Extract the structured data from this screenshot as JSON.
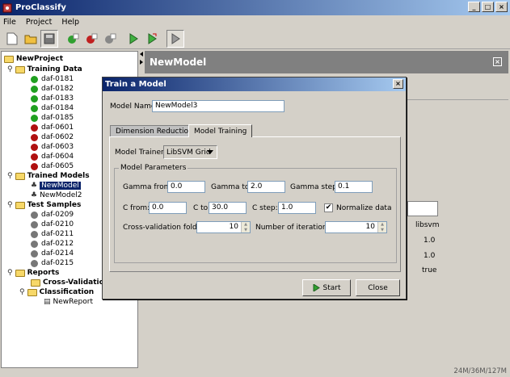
{
  "window": {
    "title": "ProClassify",
    "min": "_",
    "max": "□",
    "close": "×"
  },
  "menu": [
    "File",
    "Project",
    "Help"
  ],
  "tree": {
    "root": "NewProject",
    "training_data": {
      "label": "Training Data",
      "items": [
        {
          "label": "daf-0181",
          "color": "#20a020"
        },
        {
          "label": "daf-0182",
          "color": "#20a020"
        },
        {
          "label": "daf-0183",
          "color": "#20a020"
        },
        {
          "label": "daf-0184",
          "color": "#20a020"
        },
        {
          "label": "daf-0185",
          "color": "#20a020"
        },
        {
          "label": "daf-0601",
          "color": "#b01010"
        },
        {
          "label": "daf-0602",
          "color": "#b01010"
        },
        {
          "label": "daf-0603",
          "color": "#b01010"
        },
        {
          "label": "daf-0604",
          "color": "#b01010"
        },
        {
          "label": "daf-0605",
          "color": "#b01010"
        }
      ]
    },
    "trained_models": {
      "label": "Trained Models",
      "items": [
        "NewModel",
        "NewModel2"
      ]
    },
    "test_samples": {
      "label": "Test Samples",
      "items": [
        "daf-0209",
        "daf-0210",
        "daf-0211",
        "daf-0212",
        "daf-0214",
        "daf-0215"
      ]
    },
    "reports": {
      "label": "Reports",
      "cross_validation": "Cross-Validation",
      "classification": "Classification",
      "report": "NewReport"
    }
  },
  "right_panel": {
    "title": "NewModel",
    "close": "×",
    "values": [
      "libsvm",
      "1.0",
      "1.0",
      "true"
    ]
  },
  "status": "24M/36M/127M",
  "dialog": {
    "title": "Train a Model",
    "close": "×",
    "model_name_label": "Model Name:",
    "model_name_value": "NewModel3",
    "tabs": [
      "Dimension Reduction",
      "Model Training"
    ],
    "model_trainer_label": "Model Trainer:",
    "model_trainer_value": "LibSVM Grid",
    "group_title": "Model Parameters",
    "gamma_from_label": "Gamma from:",
    "gamma_from_value": "0.0",
    "gamma_to_label": "Gamma to:",
    "gamma_to_value": "2.0",
    "gamma_step_label": "Gamma step:",
    "gamma_step_value": "0.1",
    "c_from_label": "C from:",
    "c_from_value": "0.0",
    "c_to_label": "C to:",
    "c_to_value": "30.0",
    "c_step_label": "C step:",
    "c_step_value": "1.0",
    "normalize_label": "Normalize data",
    "normalize_checked": "✔",
    "cv_folds_label": "Cross-validation folds:",
    "cv_folds_value": "10",
    "iterations_label": "Number of iterations:",
    "iterations_value": "10",
    "start_label": "Start",
    "close_label": "Close"
  }
}
